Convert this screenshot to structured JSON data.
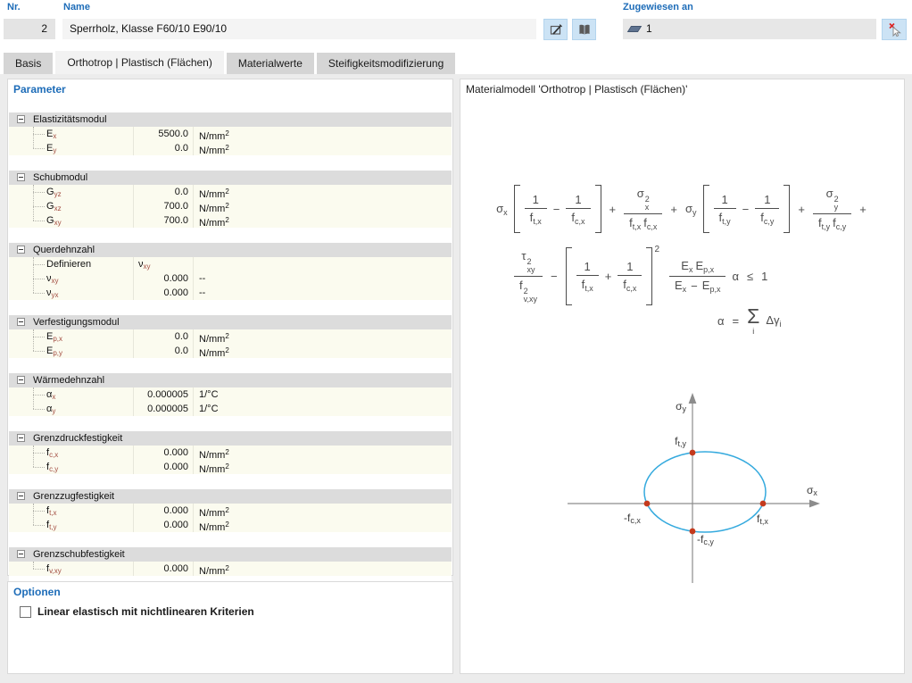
{
  "header": {
    "nr_label": "Nr.",
    "nr_value": "2",
    "name_label": "Name",
    "name_value": "Sperrholz, Klasse F60/10 E90/10",
    "assigned_label": "Zugewiesen an",
    "assigned_value": "1"
  },
  "tabs": [
    {
      "label": "Basis",
      "active": false
    },
    {
      "label": "Orthotrop | Plastisch (Flächen)",
      "active": true
    },
    {
      "label": "Materialwerte",
      "active": false
    },
    {
      "label": "Steifigkeitsmodifizierung",
      "active": false
    }
  ],
  "parameters": {
    "title": "Parameter",
    "groups": [
      {
        "label": "Elastizitätsmodul",
        "rows": [
          {
            "base": "E",
            "sub": "x",
            "value": "5500.0",
            "unit": "N/mm",
            "unit_sup": "2"
          },
          {
            "base": "E",
            "sub": "y",
            "value": "0.0",
            "unit": "N/mm",
            "unit_sup": "2"
          }
        ]
      },
      {
        "label": "Schubmodul",
        "rows": [
          {
            "base": "G",
            "sub": "yz",
            "value": "0.0",
            "unit": "N/mm",
            "unit_sup": "2"
          },
          {
            "base": "G",
            "sub": "xz",
            "value": "700.0",
            "unit": "N/mm",
            "unit_sup": "2"
          },
          {
            "base": "G",
            "sub": "xy",
            "value": "700.0",
            "unit": "N/mm",
            "unit_sup": "2"
          }
        ]
      },
      {
        "label": "Querdehnzahl",
        "rows": [
          {
            "base": "Definieren",
            "sub": "",
            "value": "",
            "unit": "",
            "sym_value": {
              "base": "ν",
              "sub": "xy"
            }
          },
          {
            "base": "ν",
            "sub": "xy",
            "value": "0.000",
            "unit": "--"
          },
          {
            "base": "ν",
            "sub": "yx",
            "value": "0.000",
            "unit": "--"
          }
        ]
      },
      {
        "label": "Verfestigungsmodul",
        "rows": [
          {
            "base": "E",
            "sub": "p,x",
            "value": "0.0",
            "unit": "N/mm",
            "unit_sup": "2"
          },
          {
            "base": "E",
            "sub": "p,y",
            "value": "0.0",
            "unit": "N/mm",
            "unit_sup": "2"
          }
        ]
      },
      {
        "label": "Wärmedehnzahl",
        "rows": [
          {
            "base": "α",
            "sub": "x",
            "value": "0.000005",
            "unit": "1/°C"
          },
          {
            "base": "α",
            "sub": "y",
            "value": "0.000005",
            "unit": "1/°C"
          }
        ]
      },
      {
        "label": "Grenzdruckfestigkeit",
        "rows": [
          {
            "base": "f",
            "sub": "c,x",
            "value": "0.000",
            "unit": "N/mm",
            "unit_sup": "2"
          },
          {
            "base": "f",
            "sub": "c,y",
            "value": "0.000",
            "unit": "N/mm",
            "unit_sup": "2"
          }
        ]
      },
      {
        "label": "Grenzzugfestigkeit",
        "rows": [
          {
            "base": "f",
            "sub": "t,x",
            "value": "0.000",
            "unit": "N/mm",
            "unit_sup": "2"
          },
          {
            "base": "f",
            "sub": "t,y",
            "value": "0.000",
            "unit": "N/mm",
            "unit_sup": "2"
          }
        ]
      },
      {
        "label": "Grenzschubfestigkeit",
        "rows": [
          {
            "base": "f",
            "sub": "v,xy",
            "value": "0.000",
            "unit": "N/mm",
            "unit_sup": "2"
          }
        ]
      }
    ]
  },
  "options": {
    "title": "Optionen",
    "checkbox_label": "Linear elastisch mit nichtlinearen Kriterien",
    "checked": false
  },
  "material_model": {
    "title": "Materialmodell 'Orthotrop | Plastisch (Flächen)'",
    "formula": {
      "lines": [
        {
          "tokens": [
            {
              "t": "sym",
              "b": "σ",
              "sub": "x"
            },
            {
              "t": "brk",
              "inner": [
                {
                  "t": "frac",
                  "num": [
                    {
                      "t": "txt",
                      "v": "1"
                    }
                  ],
                  "den": [
                    {
                      "t": "sym",
                      "b": "f",
                      "sub": "t,x"
                    }
                  ]
                },
                {
                  "t": "op",
                  "v": "−"
                },
                {
                  "t": "frac",
                  "num": [
                    {
                      "t": "txt",
                      "v": "1"
                    }
                  ],
                  "den": [
                    {
                      "t": "sym",
                      "b": "f",
                      "sub": "c,x"
                    }
                  ]
                }
              ]
            },
            {
              "t": "op",
              "v": "+"
            },
            {
              "t": "frac",
              "num": [
                {
                  "t": "sym",
                  "b": "σ",
                  "sub": "x",
                  "sup": "2"
                }
              ],
              "den": [
                {
                  "t": "sym",
                  "b": "f",
                  "sub": "t,x"
                },
                {
                  "t": "sym",
                  "b": "f",
                  "sub": "c,x"
                }
              ]
            },
            {
              "t": "op",
              "v": "+"
            },
            {
              "t": "sym",
              "b": "σ",
              "sub": "y"
            },
            {
              "t": "brk",
              "inner": [
                {
                  "t": "frac",
                  "num": [
                    {
                      "t": "txt",
                      "v": "1"
                    }
                  ],
                  "den": [
                    {
                      "t": "sym",
                      "b": "f",
                      "sub": "t,y"
                    }
                  ]
                },
                {
                  "t": "op",
                  "v": "−"
                },
                {
                  "t": "frac",
                  "num": [
                    {
                      "t": "txt",
                      "v": "1"
                    }
                  ],
                  "den": [
                    {
                      "t": "sym",
                      "b": "f",
                      "sub": "c,y"
                    }
                  ]
                }
              ]
            },
            {
              "t": "op",
              "v": "+"
            },
            {
              "t": "frac",
              "num": [
                {
                  "t": "sym",
                  "b": "σ",
                  "sub": "y",
                  "sup": "2"
                }
              ],
              "den": [
                {
                  "t": "sym",
                  "b": "f",
                  "sub": "t,y"
                },
                {
                  "t": "sym",
                  "b": "f",
                  "sub": "c,y"
                }
              ]
            },
            {
              "t": "op",
              "v": "+"
            }
          ]
        },
        {
          "tokens": [
            {
              "t": "frac",
              "num": [
                {
                  "t": "sym",
                  "b": "τ",
                  "sub": "xy",
                  "sup": "2"
                }
              ],
              "den": [
                {
                  "t": "sym",
                  "b": "f",
                  "sub": "v,xy",
                  "sup": "2"
                }
              ]
            },
            {
              "t": "op",
              "v": "−"
            },
            {
              "t": "brk",
              "sup": "2",
              "inner": [
                {
                  "t": "frac",
                  "num": [
                    {
                      "t": "txt",
                      "v": "1"
                    }
                  ],
                  "den": [
                    {
                      "t": "sym",
                      "b": "f",
                      "sub": "t,x"
                    }
                  ]
                },
                {
                  "t": "op",
                  "v": "+"
                },
                {
                  "t": "frac",
                  "num": [
                    {
                      "t": "txt",
                      "v": "1"
                    }
                  ],
                  "den": [
                    {
                      "t": "sym",
                      "b": "f",
                      "sub": "c,x"
                    }
                  ]
                }
              ]
            },
            {
              "t": "frac",
              "num": [
                {
                  "t": "sym",
                  "b": "E",
                  "sub": "x"
                },
                {
                  "t": "sym",
                  "b": "E",
                  "sub": "p,x"
                }
              ],
              "den": [
                {
                  "t": "sym",
                  "b": "E",
                  "sub": "x"
                },
                {
                  "t": "op",
                  "v": "−"
                },
                {
                  "t": "sym",
                  "b": "E",
                  "sub": "p,x"
                }
              ]
            },
            {
              "t": "sym",
              "b": "α"
            },
            {
              "t": "op",
              "v": "≤"
            },
            {
              "t": "txt",
              "v": "1"
            }
          ]
        },
        {
          "tokens": [
            {
              "t": "sym",
              "b": "α"
            },
            {
              "t": "op",
              "v": "="
            },
            {
              "t": "sum",
              "sig": "Σ",
              "below": "i"
            },
            {
              "t": "sym",
              "b": "Δγ",
              "sub": "i"
            }
          ]
        }
      ]
    },
    "diagram": {
      "sigma_y": {
        "base": "σ",
        "sub": "y"
      },
      "sigma_x": {
        "base": "σ",
        "sub": "x"
      },
      "f_ty": {
        "base": "f",
        "sub": "t,y"
      },
      "f_tx": {
        "base": "f",
        "sub": "t,x"
      },
      "f_cx": {
        "base": "-f",
        "sub": "c,x"
      },
      "f_cy": {
        "base": "-f",
        "sub": "c,y"
      }
    }
  },
  "colors": {
    "accent_blue": "#1d6cb8",
    "button_blue": "#cce3f5",
    "row_cream": "#fbfbef",
    "group_gray": "#dcdcdc",
    "ellipse_blue": "#35aade",
    "point_red": "#c43a1d",
    "subscript_red": "#a14a3e"
  }
}
